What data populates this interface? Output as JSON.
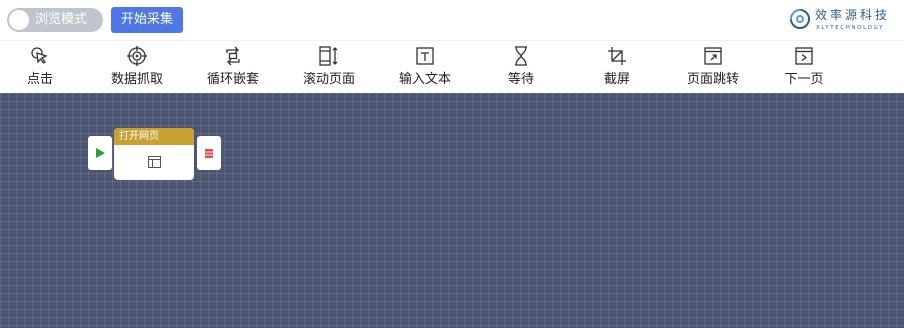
{
  "header": {
    "browse_mode_label": "浏览模式",
    "start_collect_label": "开始采集"
  },
  "brand": {
    "name": "效率源科技",
    "subtitle": "XLYTECHNOLOGY"
  },
  "toolbar": {
    "items": [
      {
        "label": "点击",
        "icon": "cursor-icon"
      },
      {
        "label": "数据抓取",
        "icon": "crosshair-icon"
      },
      {
        "label": "循环嵌套",
        "icon": "loop-icon"
      },
      {
        "label": "滚动页面",
        "icon": "scroll-icon"
      },
      {
        "label": "输入文本",
        "icon": "text-input-icon"
      },
      {
        "label": "等待",
        "icon": "hourglass-icon"
      },
      {
        "label": "截屏",
        "icon": "crop-icon"
      },
      {
        "label": "页面跳转",
        "icon": "page-jump-icon"
      },
      {
        "label": "下一页",
        "icon": "next-page-icon"
      }
    ]
  },
  "canvas": {
    "node": {
      "title": "打开网页",
      "icon": "webpage-icon"
    }
  },
  "colors": {
    "accent": "#4f78e6",
    "canvas_bg": "#4b5571",
    "node_header": "#c7a233",
    "run_green": "#2aa12a",
    "stop_red": "#e05252",
    "brand": "#2c5f8f"
  }
}
